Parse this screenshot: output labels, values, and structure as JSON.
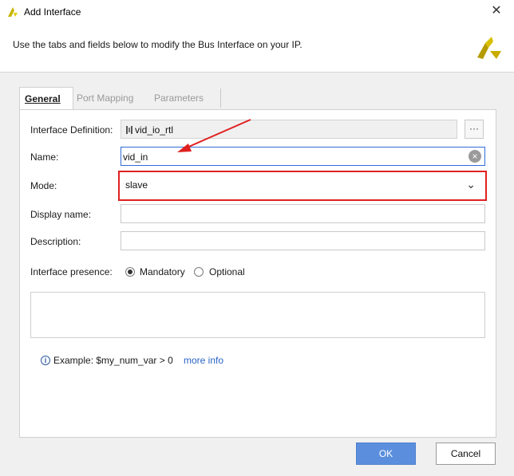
{
  "window": {
    "title": "Add Interface",
    "close_glyph": "✕"
  },
  "header": {
    "description": "Use the tabs and fields below to modify the Bus Interface on your IP."
  },
  "tabs": [
    {
      "label": "General",
      "active": true
    },
    {
      "label": "Port Mapping",
      "active": false
    },
    {
      "label": "Parameters",
      "active": false
    }
  ],
  "form": {
    "interface_definition": {
      "label": "Interface Definition:",
      "value": "vid_io_rtl",
      "browse_label": "···"
    },
    "name": {
      "label": "Name:",
      "value": "vid_in",
      "clear_glyph": "×"
    },
    "mode": {
      "label": "Mode:",
      "value": "slave",
      "chevron_glyph": "⌄"
    },
    "display_name": {
      "label": "Display name:",
      "value": ""
    },
    "description": {
      "label": "Description:",
      "value": ""
    },
    "interface_presence": {
      "label": "Interface presence:",
      "options": [
        {
          "label": "Mandatory",
          "selected": true
        },
        {
          "label": "Optional",
          "selected": false
        }
      ]
    }
  },
  "example": {
    "icon_text": "i",
    "text": "Example:  $my_num_var > 0",
    "link": "more info"
  },
  "buttons": {
    "ok": "OK",
    "cancel": "Cancel"
  },
  "colors": {
    "accent": "#5b8fde",
    "highlight": "#e02020",
    "link": "#2a64c4"
  }
}
